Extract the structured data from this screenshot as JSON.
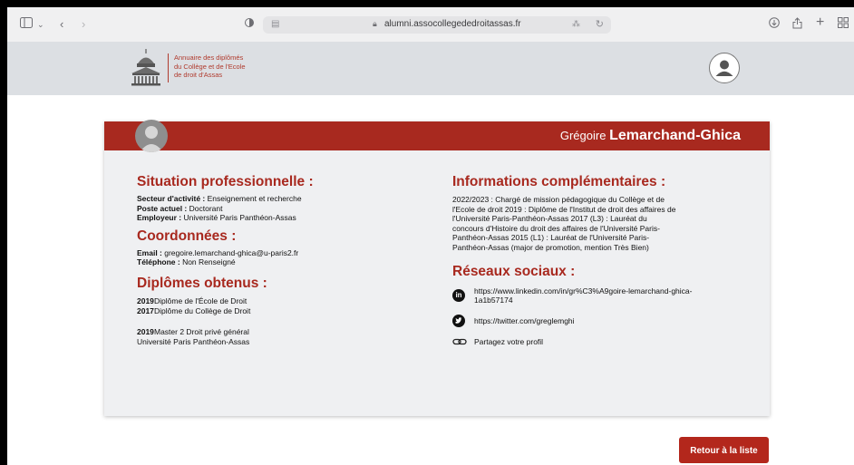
{
  "browser": {
    "url": "alumni.assocollegededroitassas.fr",
    "icons": [
      "sidebar-icon",
      "chevron-down-icon",
      "back-icon",
      "forward-icon",
      "shield-icon",
      "reader-icon",
      "lock-icon",
      "translate-icon",
      "reload-icon",
      "download-icon",
      "share-icon",
      "new-tab-icon",
      "tab-overview-icon"
    ]
  },
  "header": {
    "logo_lines": [
      "Annuaire des diplômés",
      "du Collège et de l'Ecole",
      "de droit d'Assas"
    ]
  },
  "profile": {
    "first_name": "Grégoire",
    "last_name": "Lemarchand-Ghica",
    "situation": {
      "title": "Situation professionnelle :",
      "rows": [
        {
          "label": "Secteur d'activité :",
          "value": " Enseignement et recherche"
        },
        {
          "label": "Poste actuel :",
          "value": " Doctorant"
        },
        {
          "label": "Employeur :",
          "value": " Université Paris Panthéon-Assas"
        }
      ]
    },
    "coordonnees": {
      "title": "Coordonnées :",
      "rows": [
        {
          "label": "Email :",
          "value": " gregoire.lemarchand-ghica@u-paris2.fr"
        },
        {
          "label": "Téléphone :",
          "value": " Non Renseigné"
        }
      ]
    },
    "diplomes": {
      "title": "Diplômes obtenus :",
      "items": [
        {
          "year": "2019",
          "name": "Diplôme de l'École de Droit"
        },
        {
          "year": "2017",
          "name": "Diplôme du Collège de Droit"
        }
      ],
      "master": {
        "year": "2019",
        "name": "Master 2 Droit privé général",
        "school": "Université Paris Panthéon-Assas"
      }
    },
    "infos": {
      "title": "Informations complémentaires :",
      "lines": [
        "2022/2023 : Chargé de mission pédagogique du Collège et de",
        "l'Ecole de droit 2019 : Diplôme de l'Institut de droit des affaires de",
        "l'Université Paris-Panthéon-Assas 2017 (L3) : Lauréat du",
        "concours d'Histoire du droit des affaires de l'Université Paris-",
        "Panthéon-Assas 2015 (L1) : Lauréat de l'Université Paris-",
        "Panthéon-Assas (major de promotion, mention Très Bien)"
      ]
    },
    "reseaux": {
      "title": "Réseaux sociaux :",
      "linkedin_line1": "https://www.linkedin.com/in/gr%C3%A9goire-lemarchand-ghica-",
      "linkedin_line2": "1a1b57174",
      "twitter": "https://twitter.com/greglemghi",
      "share": "Partagez votre profil"
    }
  },
  "actions": {
    "back_label": "Retour à la liste"
  },
  "colors": {
    "brand": "#a8291f",
    "card_bg": "#eff0f2",
    "header_bg": "#dcdfe3"
  }
}
